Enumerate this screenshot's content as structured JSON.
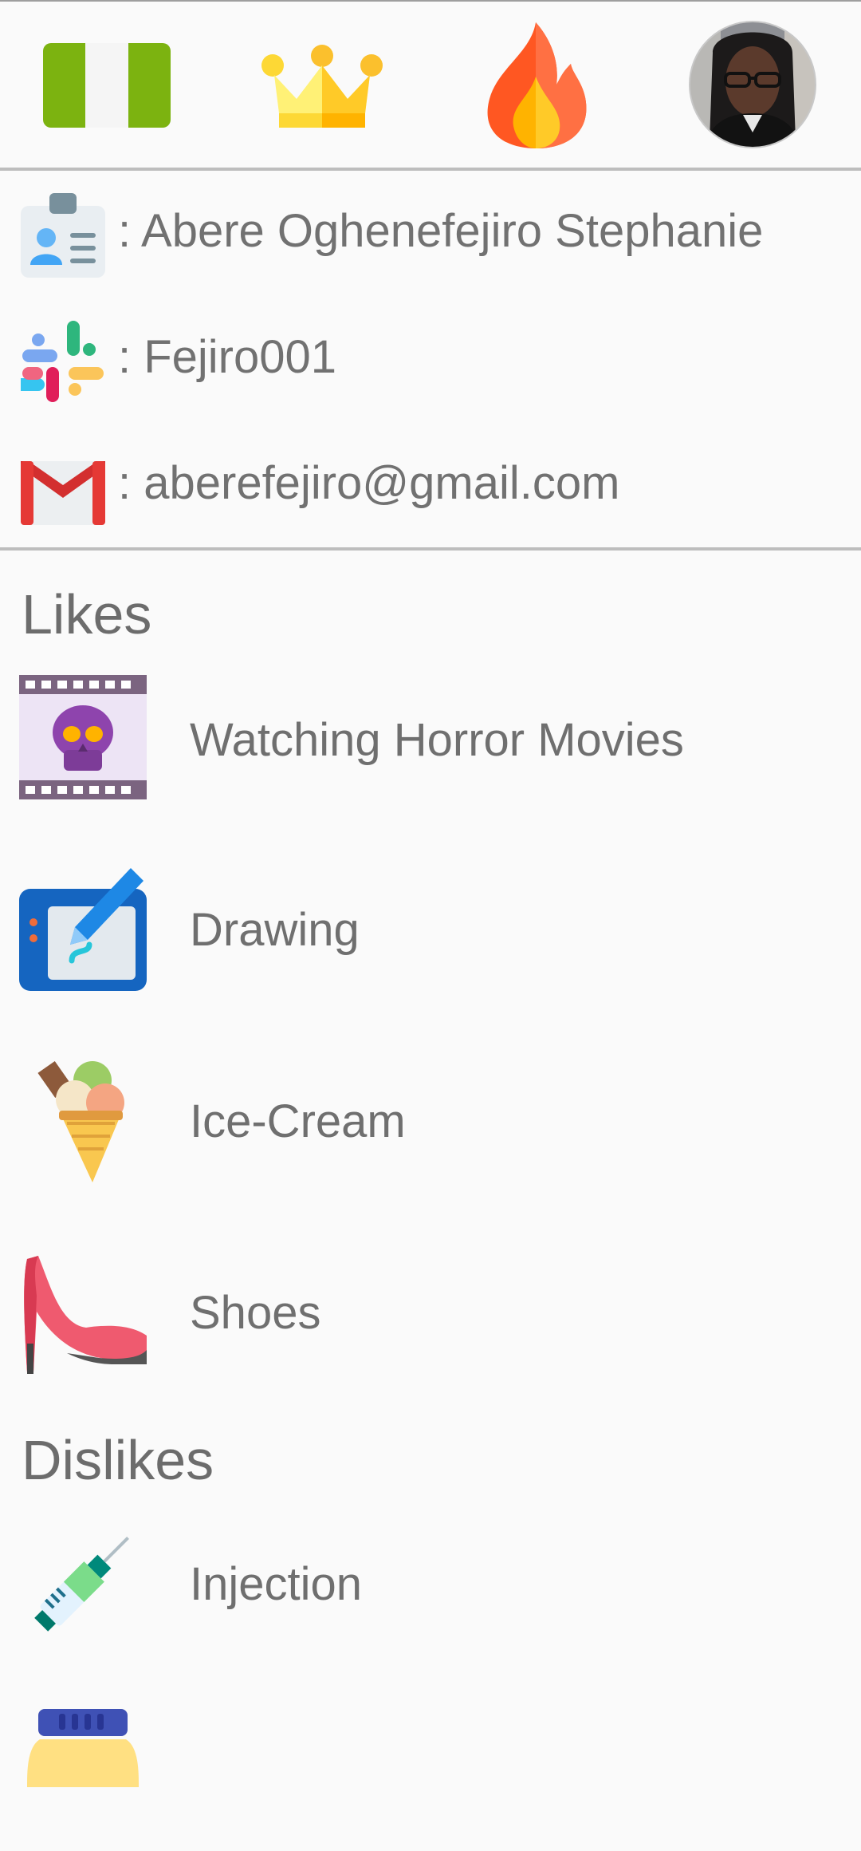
{
  "header": {
    "icons": [
      "nigeria-flag-icon",
      "crown-icon",
      "fire-icon",
      "profile-photo-avatar"
    ]
  },
  "profile": {
    "name": ": Abere Oghenefejiro Stephanie",
    "slack": ": Fejiro001",
    "email": ": aberefejiro@gmail.com"
  },
  "likes": {
    "title": "Likes",
    "items": [
      {
        "label": "Watching Horror Movies",
        "icon": "horror-movie-icon"
      },
      {
        "label": "Drawing",
        "icon": "drawing-tablet-icon"
      },
      {
        "label": "Ice-Cream",
        "icon": "ice-cream-icon"
      },
      {
        "label": "Shoes",
        "icon": "high-heel-shoe-icon"
      }
    ]
  },
  "dislikes": {
    "title": "Dislikes",
    "items": [
      {
        "label": "Injection",
        "icon": "syringe-icon"
      },
      {
        "label": "",
        "icon": "jar-icon"
      }
    ]
  }
}
